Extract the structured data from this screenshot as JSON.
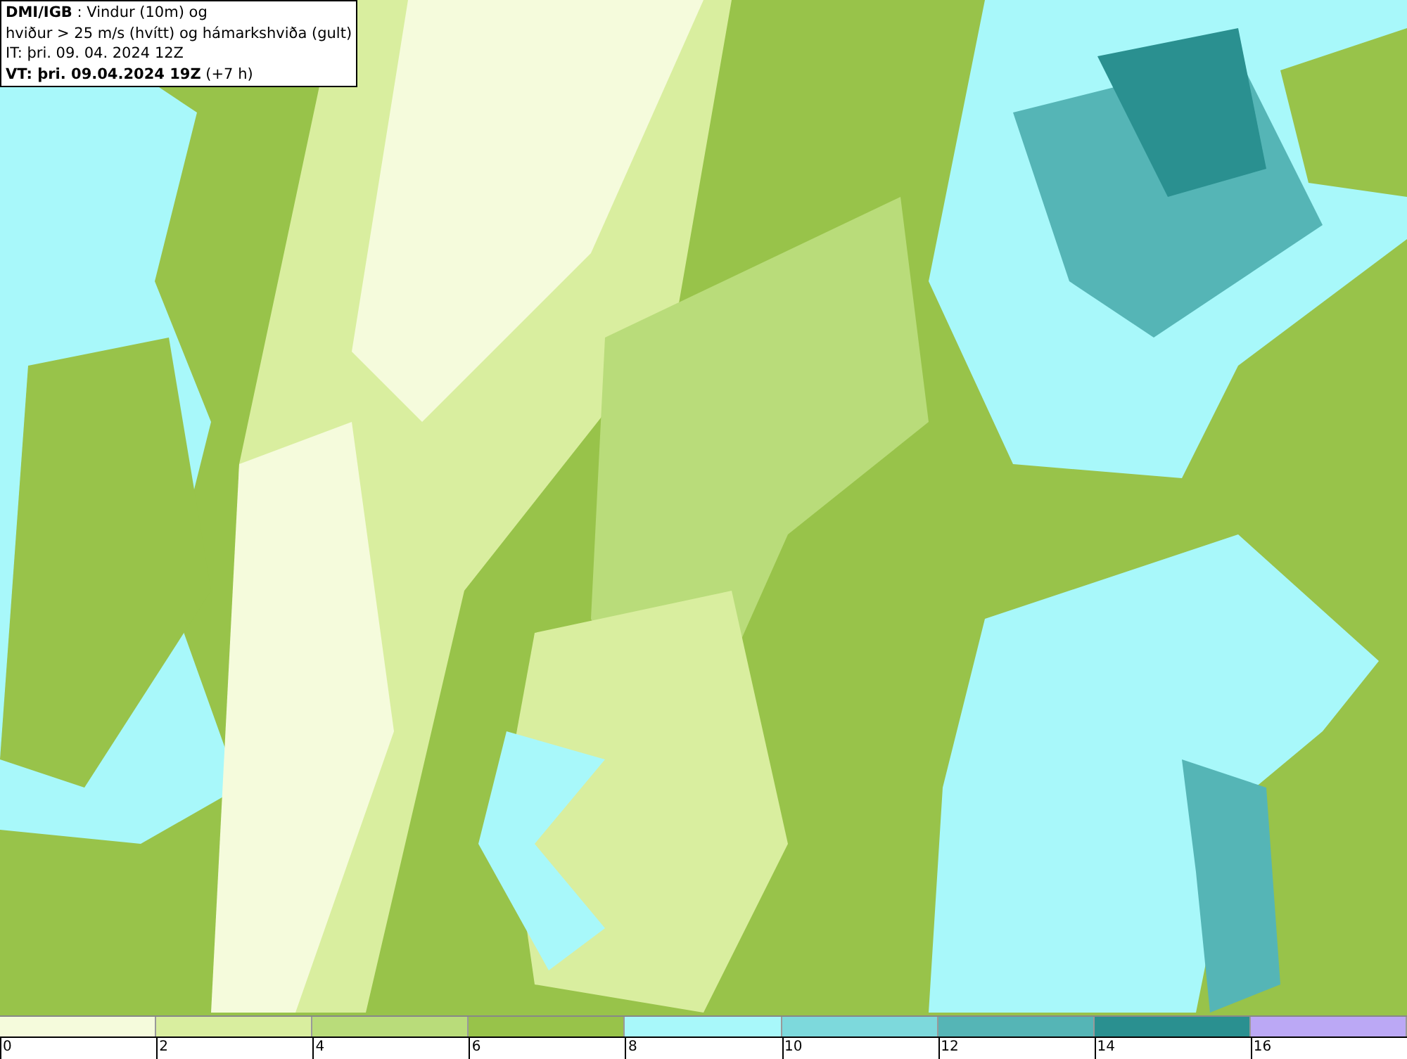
{
  "header": {
    "lines": [
      "**DMI/IGB** : Vindur (10m) og",
      "hviður > 25 m/s (hvítt) og hámarkshviða (gult)",
      "IT: þri. 09. 04. 2024 12Z",
      "**VT: þri. 09.04.2024 19Z** (+7 h)"
    ]
  },
  "legend": {
    "segments": [
      {
        "color": "#f5fbdc"
      },
      {
        "color": "#d9ee9f"
      },
      {
        "color": "#b9dc7a"
      },
      {
        "color": "#98c34a"
      },
      {
        "color": "#a8f8fa"
      },
      {
        "color": "#7dd9dc"
      },
      {
        "color": "#55b5b6"
      },
      {
        "color": "#2a9090"
      },
      {
        "color": "#bba8f5"
      }
    ],
    "ticks": [
      "0",
      "2",
      "4",
      "6",
      "8",
      "10",
      "12",
      "14",
      "16"
    ]
  }
}
